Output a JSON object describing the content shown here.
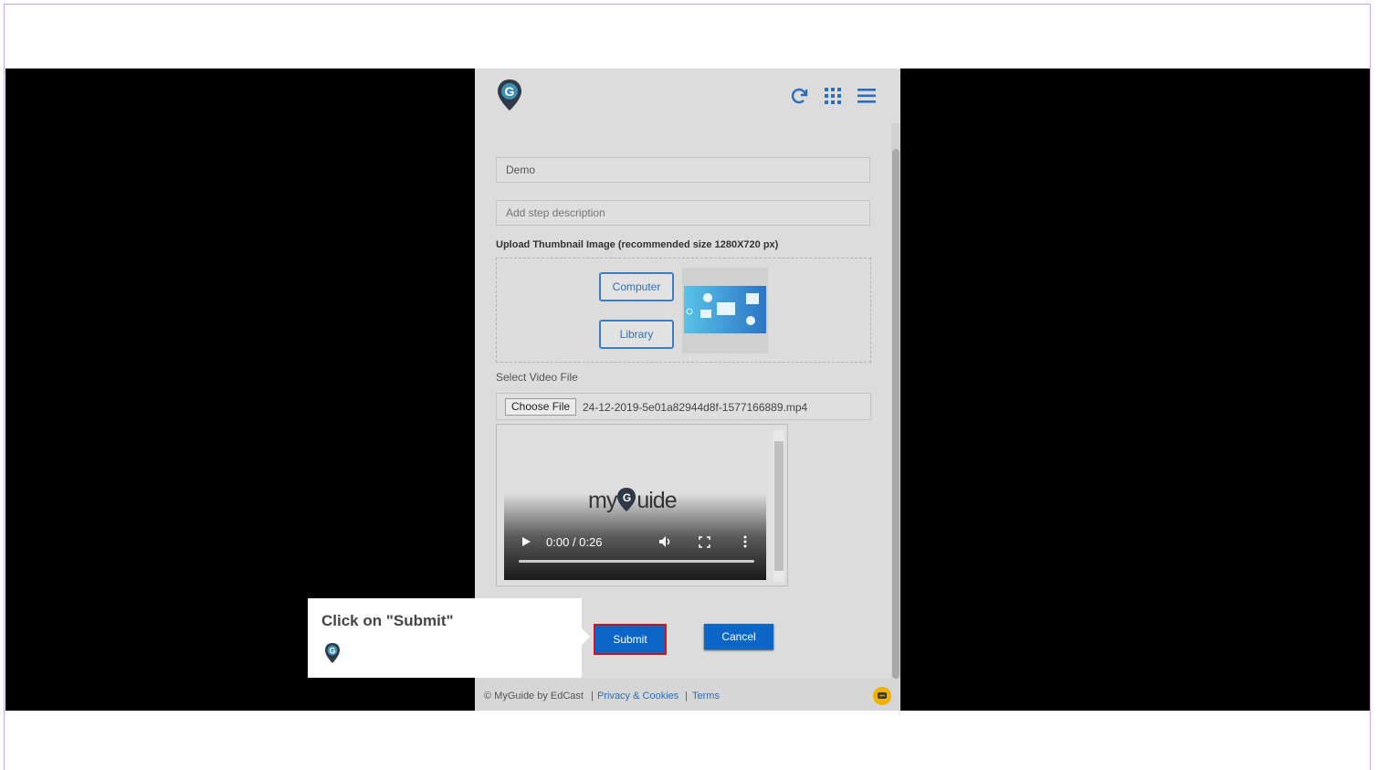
{
  "header": {
    "icons": [
      "myguide-logo-icon",
      "refresh-icon",
      "apps-grid-icon",
      "hamburger-menu-icon"
    ]
  },
  "form": {
    "title_value": "Demo",
    "description_placeholder": "Add step description",
    "upload_label": "Upload Thumbnail Image (recommended size 1280X720 px)",
    "computer_button": "Computer",
    "library_button": "Library",
    "video_label": "Select Video File",
    "choose_file_button": "Choose File",
    "file_name": "24-12-2019-5e01a82944d8f-1577166889.mp4"
  },
  "video": {
    "brand_text_left": "my",
    "brand_text_right": "uide",
    "time": "0:00 / 0:26",
    "progress": 0
  },
  "actions": {
    "submit_label": "Submit",
    "cancel_label": "Cancel"
  },
  "footer": {
    "copyright": "© MyGuide by EdCast",
    "separator": "|",
    "privacy": "Privacy & Cookies",
    "terms": "Terms"
  },
  "callout": {
    "text": "Click on \"Submit\""
  },
  "colors": {
    "primary": "#0b66c8",
    "highlight": "#d6101c",
    "outline_button": "#3c7fbf",
    "chat": "#f0b400"
  }
}
